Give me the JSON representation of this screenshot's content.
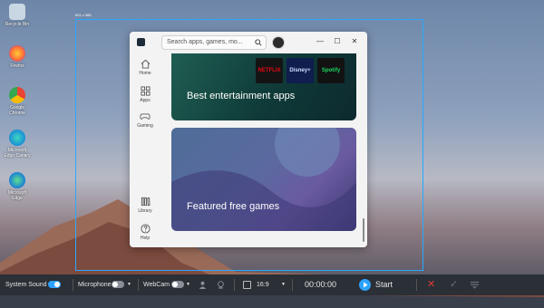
{
  "desktop": {
    "icons": [
      {
        "label": "Recycle Bin",
        "icon": "recycle-bin-icon"
      },
      {
        "label": "Firefox",
        "icon": "firefox-icon"
      },
      {
        "label": "Google Chrome",
        "icon": "chrome-icon"
      },
      {
        "label": "Microsoft Edge Canary",
        "icon": "edge-canary-icon"
      },
      {
        "label": "Microsoft Edge",
        "icon": "edge-icon"
      }
    ],
    "capture_dimensions": "601 x 385"
  },
  "store": {
    "search_placeholder": "Search apps, games, mo...",
    "window_buttons": {
      "minimize": "—",
      "maximize": "☐",
      "close": "✕"
    },
    "nav": [
      {
        "label": "Home",
        "icon": "home-icon"
      },
      {
        "label": "Apps",
        "icon": "apps-grid-icon"
      },
      {
        "label": "Gaming",
        "icon": "gamepad-icon"
      },
      {
        "label": "Library",
        "icon": "library-icon"
      },
      {
        "label": "Help",
        "icon": "help-icon"
      }
    ],
    "cards": [
      {
        "title": "Best entertainment apps",
        "logos": [
          "NETFLIX",
          "Disney+",
          "Spotify"
        ]
      },
      {
        "title": "Featured free games"
      }
    ]
  },
  "recorder": {
    "system_sound_label": "System Sound",
    "microphone_label": "Microphone",
    "webcam_label": "WebCam",
    "aspect_ratio": "16:9",
    "timer": "00:00:00",
    "start_label": "Start",
    "colors": {
      "accent": "#2da3ff",
      "cancel": "#e03c3c",
      "bar": "#2b2f36"
    }
  }
}
